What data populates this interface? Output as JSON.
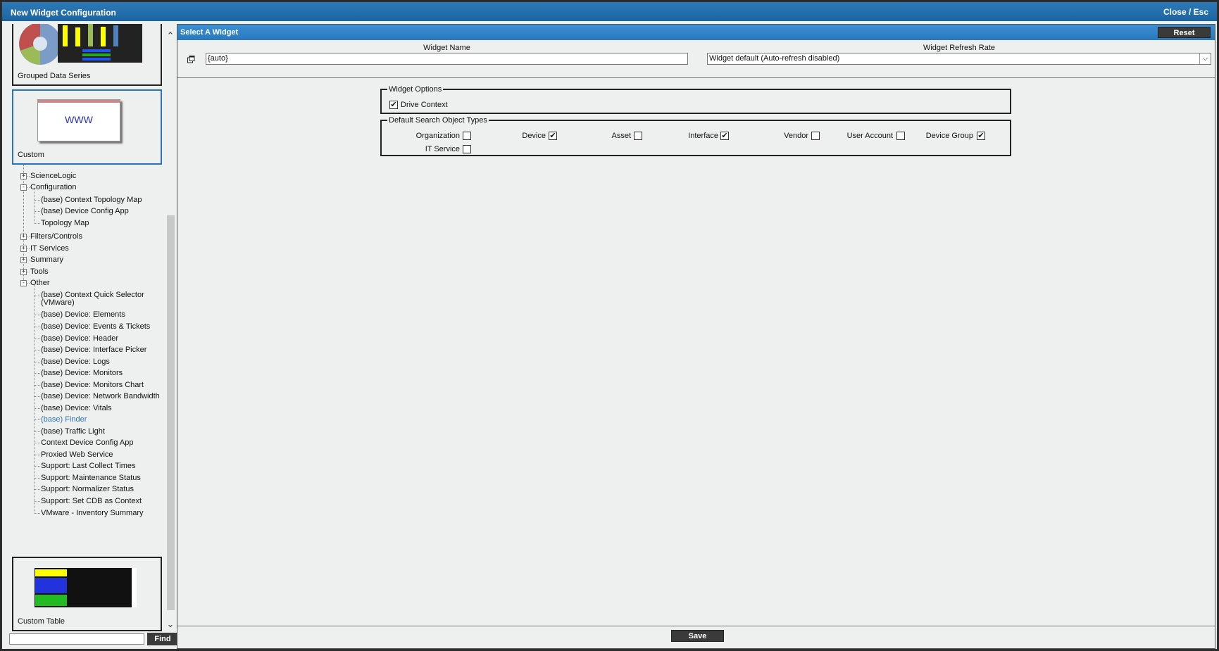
{
  "window": {
    "title": "New Widget Configuration",
    "close_label": "Close / Esc"
  },
  "left": {
    "cards": {
      "grouped": {
        "label": "Grouped Data Series"
      },
      "custom": {
        "label": "Custom",
        "thumb_text": "WWW"
      },
      "custom_table": {
        "label": "Custom Table"
      }
    },
    "tree": {
      "science_logic": "ScienceLogic",
      "configuration": "Configuration",
      "config_items": [
        "(base) Context Topology Map",
        "(base) Device Config App",
        "Topology Map"
      ],
      "filters": "Filters/Controls",
      "it_services": "IT Services",
      "summary": "Summary",
      "tools": "Tools",
      "other": "Other",
      "other_items": [
        "(base) Context Quick Selector (VMware)",
        "(base) Device: Elements",
        "(base) Device: Events & Tickets",
        "(base) Device: Header",
        "(base) Device: Interface Picker",
        "(base) Device: Logs",
        "(base) Device: Monitors",
        "(base) Device: Monitors Chart",
        "(base) Device: Network Bandwidth",
        "(base) Device: Vitals",
        "(base) Finder",
        "(base) Traffic Light",
        "Context Device Config App",
        "Proxied Web Service",
        "Support: Last Collect Times",
        "Support: Maintenance Status",
        "Support: Normalizer Status",
        "Support: Set CDB as Context",
        "VMware - Inventory Summary"
      ],
      "selected_color": "#2f72b2"
    },
    "find": {
      "value": "",
      "button": "Find"
    }
  },
  "right": {
    "header": "Select A Widget",
    "reset": "Reset",
    "widget_name_label": "Widget Name",
    "widget_name_value": "{auto}",
    "refresh_label": "Widget Refresh Rate",
    "refresh_value": "Widget default (Auto-refresh disabled)",
    "options": {
      "legend": "Widget Options",
      "drive_context": {
        "label": "Drive Context",
        "checked": true
      }
    },
    "types": {
      "legend": "Default Search Object Types",
      "organization": {
        "label": "Organization",
        "checked": false
      },
      "device": {
        "label": "Device",
        "checked": true
      },
      "asset": {
        "label": "Asset",
        "checked": false
      },
      "interface": {
        "label": "Interface",
        "checked": true
      },
      "vendor": {
        "label": "Vendor",
        "checked": false
      },
      "user_account": {
        "label": "User Account",
        "checked": false
      },
      "device_group": {
        "label": "Device Group",
        "checked": true
      },
      "it_service": {
        "label": "IT Service",
        "checked": false
      }
    },
    "save": "Save"
  }
}
